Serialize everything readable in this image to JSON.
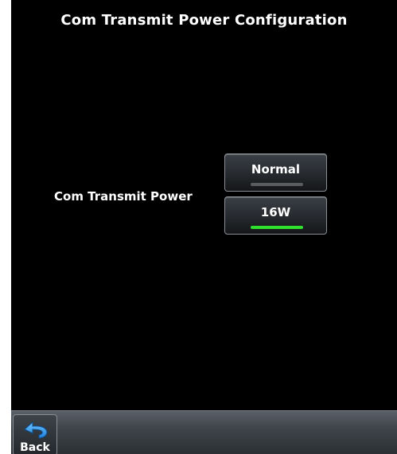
{
  "screen": {
    "title": "Com Transmit Power Configuration"
  },
  "setting": {
    "label": "Com Transmit Power",
    "options": [
      {
        "label": "Normal",
        "selected": false
      },
      {
        "label": "16W",
        "selected": true
      }
    ]
  },
  "bottom_bar": {
    "back_label": "Back",
    "back_icon": "back-arrow-icon"
  },
  "colors": {
    "background": "#000000",
    "selected_indicator": "#2fe02f",
    "unselected_indicator": "#5a5c5e",
    "text": "#ffffff"
  }
}
